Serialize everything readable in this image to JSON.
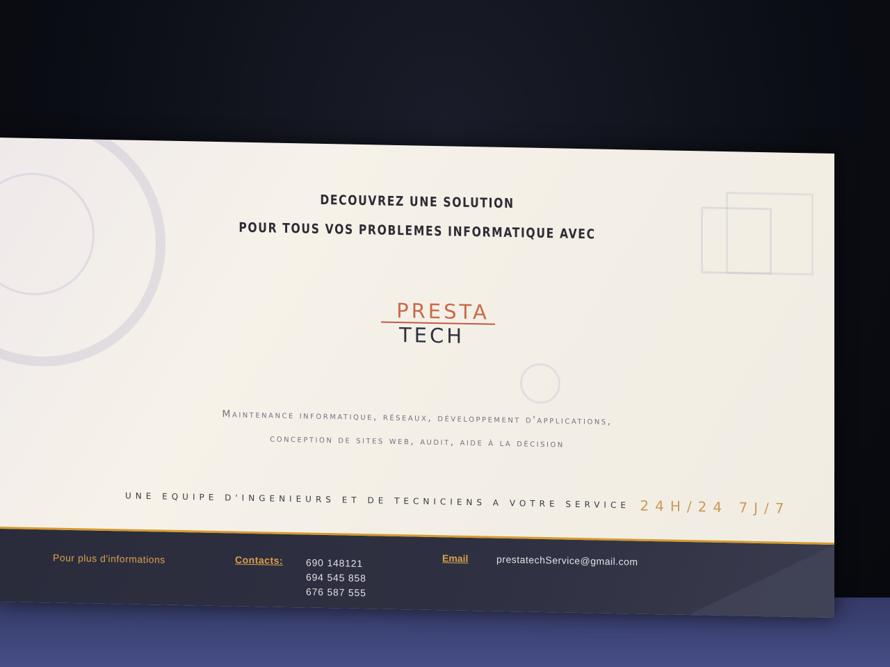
{
  "headline": {
    "line1": "DECOUVREZ UNE SOLUTION",
    "line2": "POUR TOUS VOS PROBLEMES INFORMATIQUE AVEC"
  },
  "logo": {
    "top": "PRESTA",
    "bottom": "TECH"
  },
  "services": {
    "line1": "Maintenance informatique, réseaux, développement d'applications,",
    "line2": "conception de sites web, audit, aide à la décision"
  },
  "tagline": {
    "text": "UNE EQUIPE D'INGENIEURS ET DE TECNICIENS A VOTRE SERVICE",
    "hours": "24H/24 7J/7"
  },
  "footer": {
    "info_label": "Pour plus d'informations",
    "contacts_label": "Contacts:",
    "phones": [
      "690 148121",
      "694 545 858",
      "676 587 555"
    ],
    "email_label": "Email",
    "email": "prestatechService@gmail.com"
  },
  "colors": {
    "accent": "#d9a24a",
    "logo_orange": "#c86a4a",
    "footer_bg": "#2a2c3c",
    "page_bg": "#f3efe6"
  }
}
